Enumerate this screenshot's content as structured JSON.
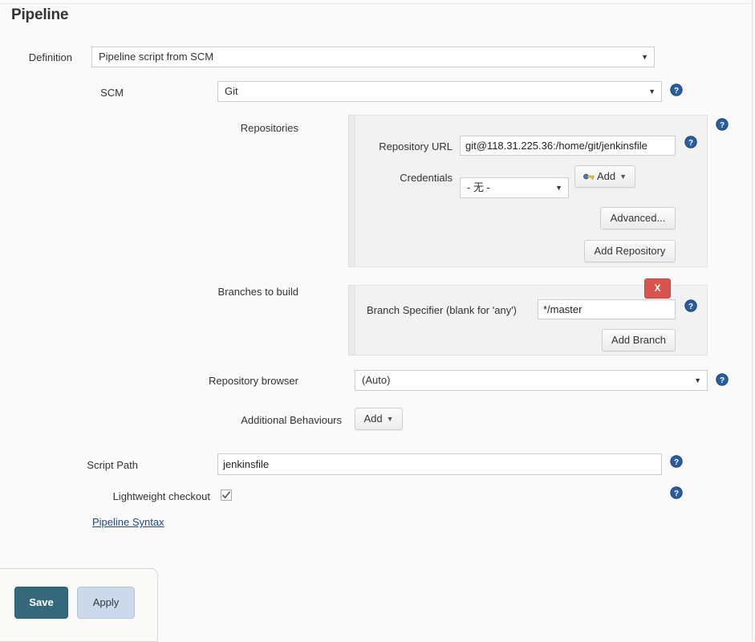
{
  "page": {
    "title": "Pipeline"
  },
  "definition": {
    "label": "Definition",
    "value": "Pipeline script from SCM"
  },
  "scm": {
    "label": "SCM",
    "value": "Git"
  },
  "repositories": {
    "label": "Repositories",
    "repository_url": {
      "label": "Repository URL",
      "value": "git@118.31.225.36:/home/git/jenkinsfile"
    },
    "credentials": {
      "label": "Credentials",
      "value": "- 无 -",
      "add_label": "Add"
    },
    "advanced_label": "Advanced...",
    "add_repository_label": "Add Repository"
  },
  "branches": {
    "label": "Branches to build",
    "delete_label": "X",
    "branch_specifier": {
      "label": "Branch Specifier (blank for 'any')",
      "value": "*/master"
    },
    "add_branch_label": "Add Branch"
  },
  "repository_browser": {
    "label": "Repository browser",
    "value": "(Auto)"
  },
  "additional_behaviours": {
    "label": "Additional Behaviours",
    "add_label": "Add"
  },
  "script_path": {
    "label": "Script Path",
    "value": "jenkinsfile"
  },
  "lightweight_checkout": {
    "label": "Lightweight checkout",
    "checked": true
  },
  "pipeline_syntax_link": "Pipeline Syntax",
  "actions": {
    "save_label": "Save",
    "apply_label": "Apply"
  },
  "colors": {
    "save_button": "#33697a",
    "apply_button": "#ccd9ea",
    "delete_button": "#d9534f",
    "help_icon": "#2a5d9e",
    "link": "#214a80"
  }
}
